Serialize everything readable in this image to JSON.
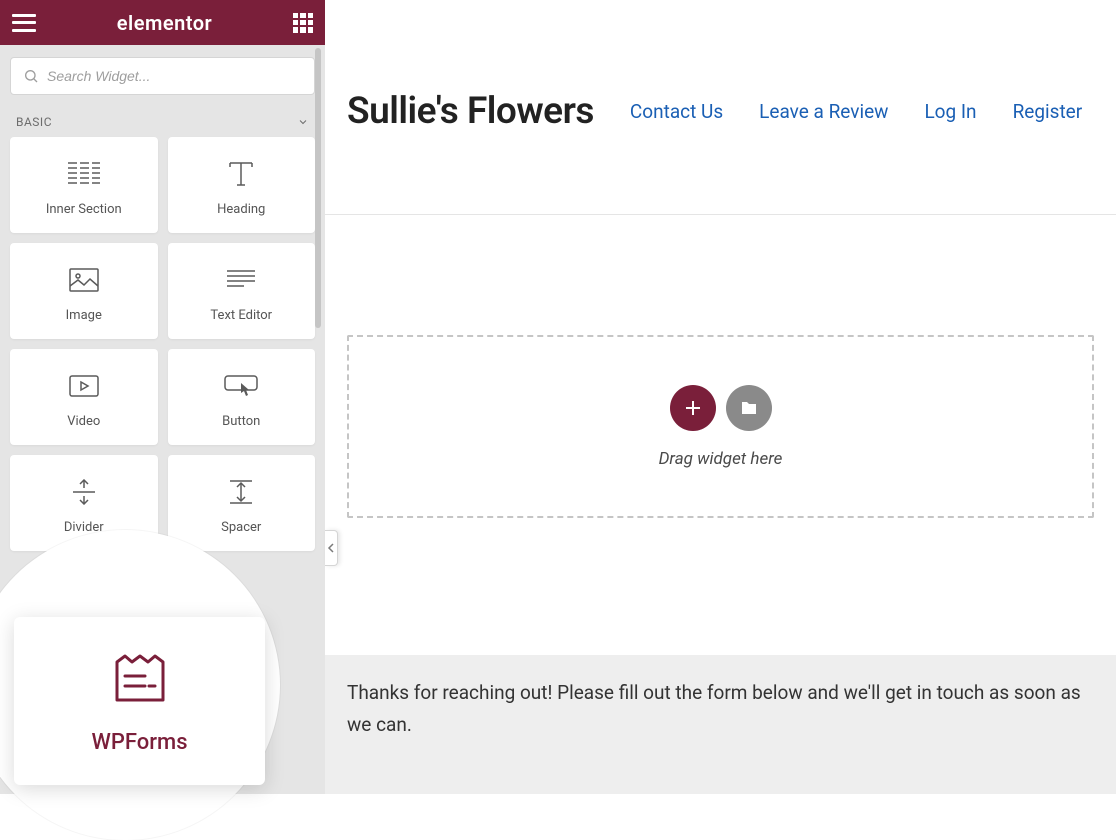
{
  "sidebar": {
    "logo": "elementor",
    "search_placeholder": "Search Widget...",
    "category": "BASIC",
    "widgets": [
      {
        "label": "Inner Section"
      },
      {
        "label": "Heading"
      },
      {
        "label": "Image"
      },
      {
        "label": "Text Editor"
      },
      {
        "label": "Video"
      },
      {
        "label": "Button"
      },
      {
        "label": "Divider"
      },
      {
        "label": "Spacer"
      }
    ],
    "highlighted_widget": "WPForms"
  },
  "page": {
    "title": "Sullie's Flowers",
    "nav": [
      "Contact Us",
      "Leave a Review",
      "Log In",
      "Register"
    ],
    "dropzone_text": "Drag widget here",
    "footer_text": "Thanks for reaching out! Please fill out the form below and we'll get in touch as soon as we can."
  }
}
